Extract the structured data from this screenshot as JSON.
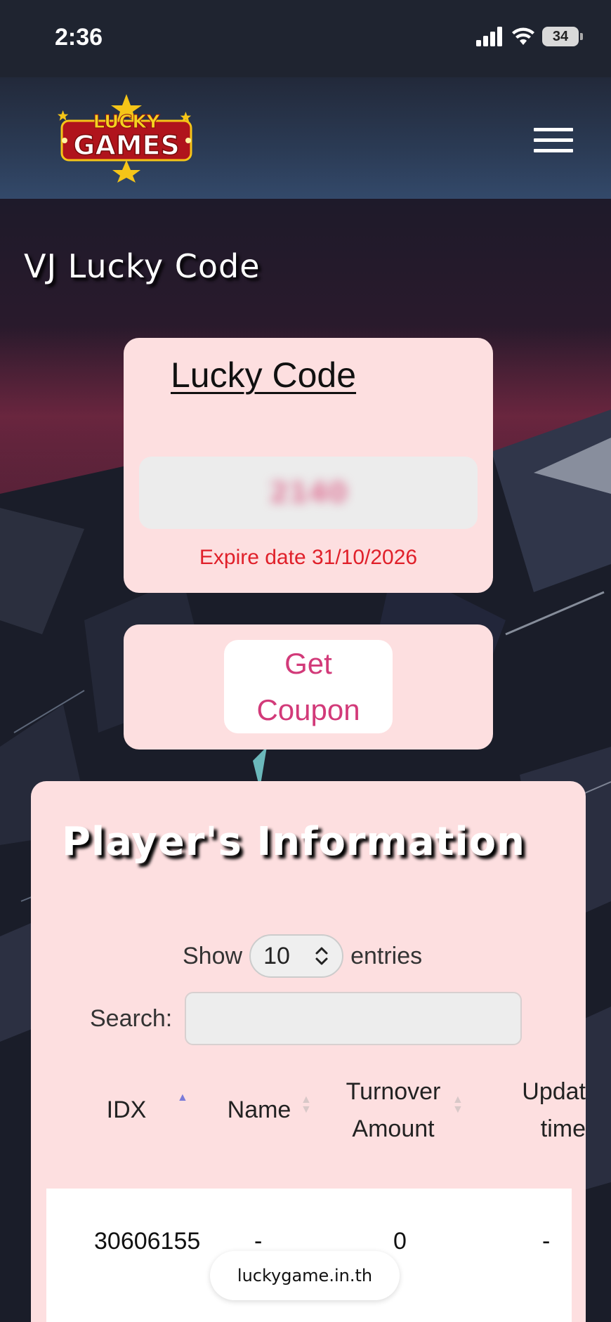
{
  "status_bar": {
    "time": "2:36",
    "battery": "34"
  },
  "header": {
    "logo_top": "LUCKY",
    "logo_bottom": "GAMES"
  },
  "page": {
    "title": "VJ Lucky Code"
  },
  "lucky_card": {
    "heading": "Lucky Code",
    "code": "2140",
    "expire": "Expire date 31/10/2026"
  },
  "coupon": {
    "label_line1": "Get",
    "label_line2": "Coupon"
  },
  "player": {
    "title": "Player's Information",
    "show_label": "Show",
    "entries_value": "10",
    "entries_label": "entries",
    "search_label": "Search:",
    "search_value": "",
    "columns": [
      {
        "line1": "IDX",
        "line2": ""
      },
      {
        "line1": "Name",
        "line2": ""
      },
      {
        "line1": "Turnover",
        "line2": "Amount"
      },
      {
        "line1": "Updat",
        "line2": "time"
      }
    ],
    "rows": [
      {
        "idx": "30606155",
        "name": "-",
        "turnover": "0",
        "update": "-"
      }
    ]
  },
  "browser": {
    "url": "luckygame.in.th"
  },
  "colors": {
    "card_bg": "#fddfe0",
    "accent_pink": "#d23a79",
    "expire_red": "#e0202a",
    "sort_active": "#7b7bd8"
  }
}
